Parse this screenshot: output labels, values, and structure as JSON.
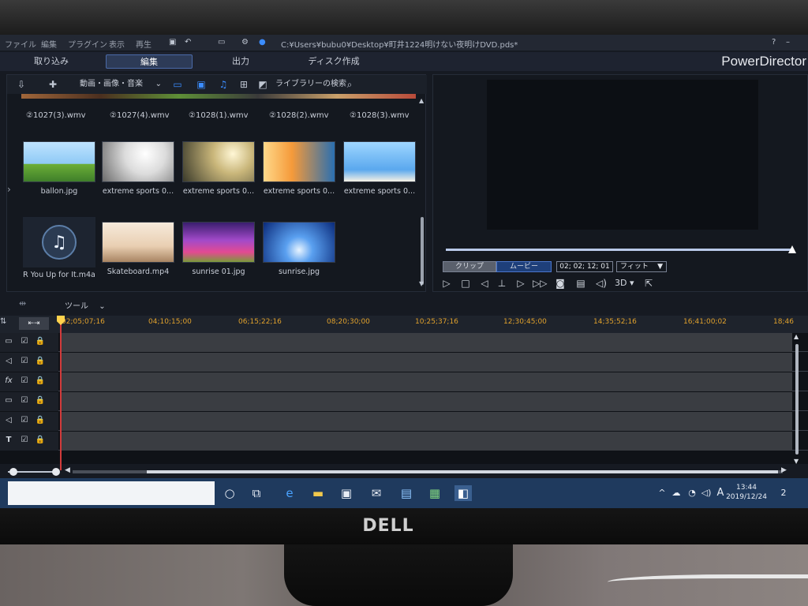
{
  "menubar": {
    "items": [
      "ファイル",
      "編集",
      "プラグイン",
      "表示",
      "再生"
    ],
    "title": "C:¥Users¥bubu0¥Desktop¥町井1224明けない夜明けDVD.pds*",
    "help": "?"
  },
  "modes": [
    {
      "label": "取り込み"
    },
    {
      "label": "編集"
    },
    {
      "label": "出力"
    },
    {
      "label": "ディスク作成"
    }
  ],
  "brand": "PowerDirector",
  "library": {
    "filter_label": "動画・画像・音楽",
    "search_label": "ライブラリーの検索",
    "top_row": [
      "②1027(3).wmv",
      "②1027(4).wmv",
      "②1028(1).wmv",
      "②1028(2).wmv",
      "②1028(3).wmv"
    ],
    "items_row1": [
      {
        "label": "ballon.jpg",
        "colors": [
          "#cfe9ff",
          "#7bbf3b"
        ]
      },
      {
        "label": "extreme sports 0...",
        "colors": [
          "#ffffff",
          "#6b6b6b"
        ]
      },
      {
        "label": "extreme sports 0...",
        "colors": [
          "#fff3c2",
          "#3a3a2a"
        ]
      },
      {
        "label": "extreme sports 0...",
        "colors": [
          "#fbd36a",
          "#2a6fb0"
        ]
      },
      {
        "label": "extreme sports 0...",
        "colors": [
          "#7fc3ff",
          "#2a6fb0"
        ]
      }
    ],
    "items_row2": [
      {
        "label": "R You Up for It.m4a",
        "type": "music"
      },
      {
        "label": "Skateboard.mp4",
        "colors": [
          "#f4e2cf",
          "#b08a66"
        ]
      },
      {
        "label": "sunrise 01.jpg",
        "colors": [
          "#7b2a9b",
          "#e34a92"
        ]
      },
      {
        "label": "sunrise.jpg",
        "colors": [
          "#0a2a7a",
          "#7fb8ff"
        ]
      }
    ]
  },
  "preview": {
    "clip_label": "クリップ",
    "movie_label": "ムービー",
    "timecode": "02; 02; 12; 01",
    "fit_label": "フィット",
    "mode_3d": "3D"
  },
  "timeline": {
    "tool_label": "ツール",
    "ruler": [
      "02;05;07;16",
      "04;10;15;00",
      "06;15;22;16",
      "08;20;30;00",
      "10;25;37;16",
      "12;30;45;00",
      "14;35;52;16",
      "16;41;00;02",
      "18;46"
    ],
    "track_icons": [
      "video-track-icon",
      "audio-track-icon",
      "fx-track-icon",
      "video-track-icon",
      "audio-track-icon",
      "title-track-icon"
    ],
    "track_glyphs": [
      "▭",
      "◁",
      "fx",
      "▭",
      "◁",
      "T"
    ]
  },
  "taskbar": {
    "time": "13:44",
    "date": "2019/12/24",
    "ime": "A",
    "notifications": "2"
  },
  "monitor_brand": "DELL"
}
